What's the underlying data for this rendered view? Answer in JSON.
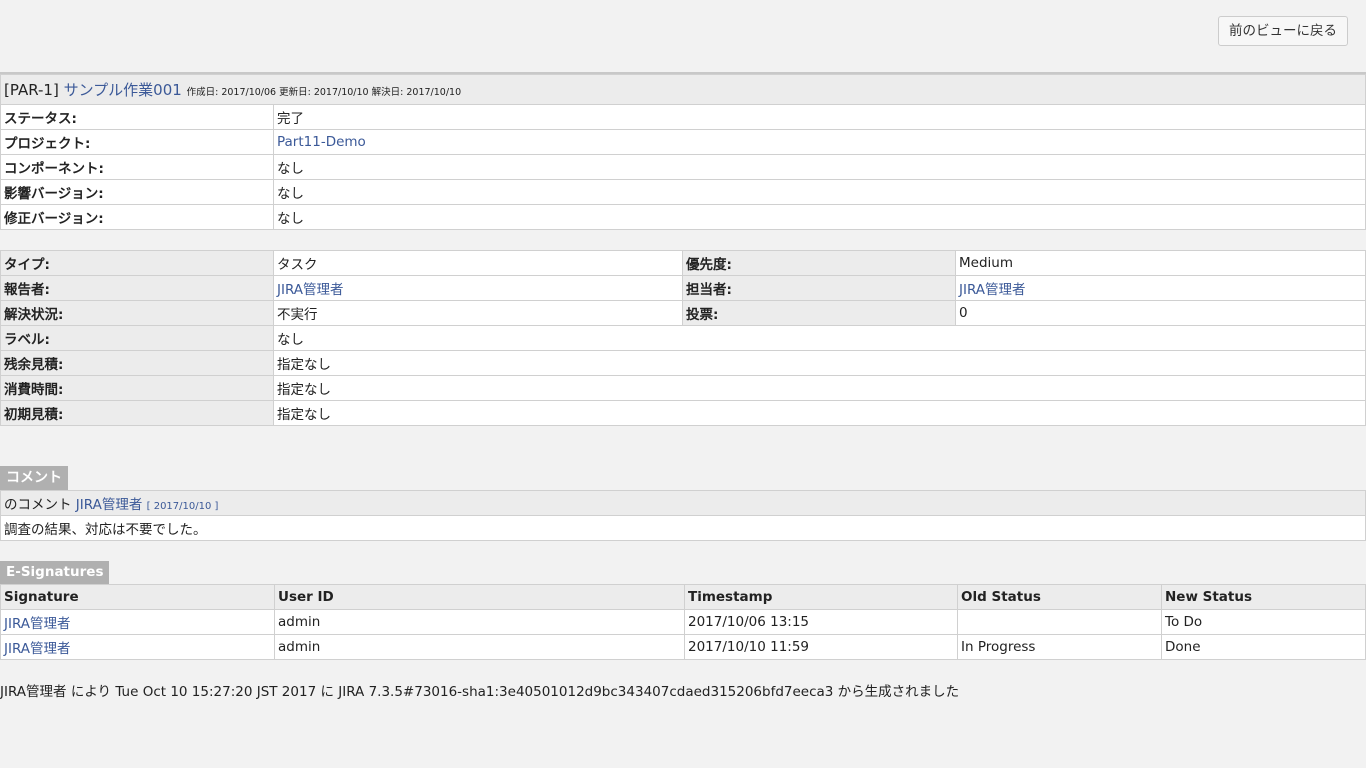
{
  "topbar": {
    "back_button": "前のビューに戻る"
  },
  "issue": {
    "key": "[PAR-1]",
    "summary": "サンプル作業001",
    "created_label": "作成日:",
    "created": "2017/10/06",
    "updated_label": "更新日:",
    "updated": "2017/10/10",
    "resolved_label": "解決日:",
    "resolved": "2017/10/10"
  },
  "fields1": [
    {
      "label": "ステータス:",
      "value": "完了",
      "link": false
    },
    {
      "label": "プロジェクト:",
      "value": "Part11-Demo",
      "link": true
    },
    {
      "label": "コンポーネント:",
      "value": "なし",
      "link": false
    },
    {
      "label": "影響バージョン:",
      "value": "なし",
      "link": false
    },
    {
      "label": "修正バージョン:",
      "value": "なし",
      "link": false
    }
  ],
  "fields2": {
    "type_label": "タイプ:",
    "type": "タスク",
    "priority_label": "優先度:",
    "priority": "Medium",
    "reporter_label": "報告者:",
    "reporter": "JIRA管理者",
    "assignee_label": "担当者:",
    "assignee": "JIRA管理者",
    "resolution_label": "解決状況:",
    "resolution": "不実行",
    "votes_label": "投票:",
    "votes": "0",
    "labels_label": "ラベル:",
    "labels": "なし",
    "remaining_label": "残余見積:",
    "remaining": "指定なし",
    "spent_label": "消費時間:",
    "spent": "指定なし",
    "original_label": "初期見積:",
    "original": "指定なし"
  },
  "comments": {
    "title": "コメント",
    "prefix": "のコメント",
    "author": "JIRA管理者",
    "date": "[ 2017/10/10 ]",
    "body": "調査の結果、対応は不要でした。"
  },
  "signatures": {
    "title": "E-Signatures",
    "headers": [
      "Signature",
      "User ID",
      "Timestamp",
      "Old Status",
      "New Status"
    ],
    "rows": [
      [
        "JIRA管理者",
        "admin",
        "2017/10/06 13:15",
        "",
        "To Do"
      ],
      [
        "JIRA管理者",
        "admin",
        "2017/10/10 11:59",
        "In Progress",
        "Done"
      ]
    ]
  },
  "footer": "JIRA管理者 により Tue Oct 10 15:27:20 JST 2017 に JIRA 7.3.5#73016-sha1:3e40501012d9bc343407cdaed315206bfd7eeca3 から生成されました"
}
